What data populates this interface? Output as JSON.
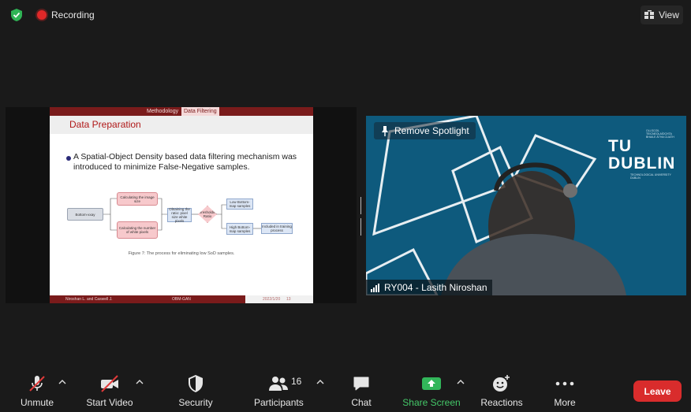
{
  "top": {
    "recording_label": "Recording",
    "view_label": "View"
  },
  "slide": {
    "crumb_left": "Methodology",
    "crumb_right": "Data Filtering",
    "title": "Data Preparation",
    "bullet": "A Spatial-Object Density based data filtering mechanism was introduced to minimize False-Negative samples.",
    "caption": "Figure 7: The process for eliminating low SoD samples.",
    "footer_left": "Niroshan L. and Caswell J.",
    "footer_mid": "OBM-GAN",
    "footer_date": "2022/1/20",
    "footer_page": "13",
    "figure": {
      "n1": "Bottom-xxay",
      "n2": "Calculating the image size",
      "n3": "Calculating the number of white pixels",
      "n4": "Obtaining the ratio: pixel size white pixels",
      "n5": "Thresholding Ratio",
      "n6": "Low Bottom-map samples",
      "n7": "High Bottom-map samples",
      "n8": "Included in training process"
    }
  },
  "video": {
    "spotlight_label": "Remove Spotlight",
    "name": "RY004 - Lasith Niroshan",
    "brand_word": "TU DUBLIN",
    "brand_small": "OLLSCOIL TEICNEOLAÍOCHTA BHAILE ÁTHA CLIATH",
    "brand_small2": "TECHNOLOGICAL UNIVERSITY DUBLIN"
  },
  "toolbar": {
    "unmute": "Unmute",
    "start_video": "Start Video",
    "security": "Security",
    "participants": "Participants",
    "participants_count": "16",
    "chat": "Chat",
    "share_screen": "Share Screen",
    "reactions": "Reactions",
    "more": "More",
    "leave": "Leave"
  },
  "colors": {
    "accent_green": "#44c768",
    "leave_red": "#d92c2c",
    "video_bg": "#0e5a7d",
    "slide_maroon": "#7a1b1b"
  }
}
